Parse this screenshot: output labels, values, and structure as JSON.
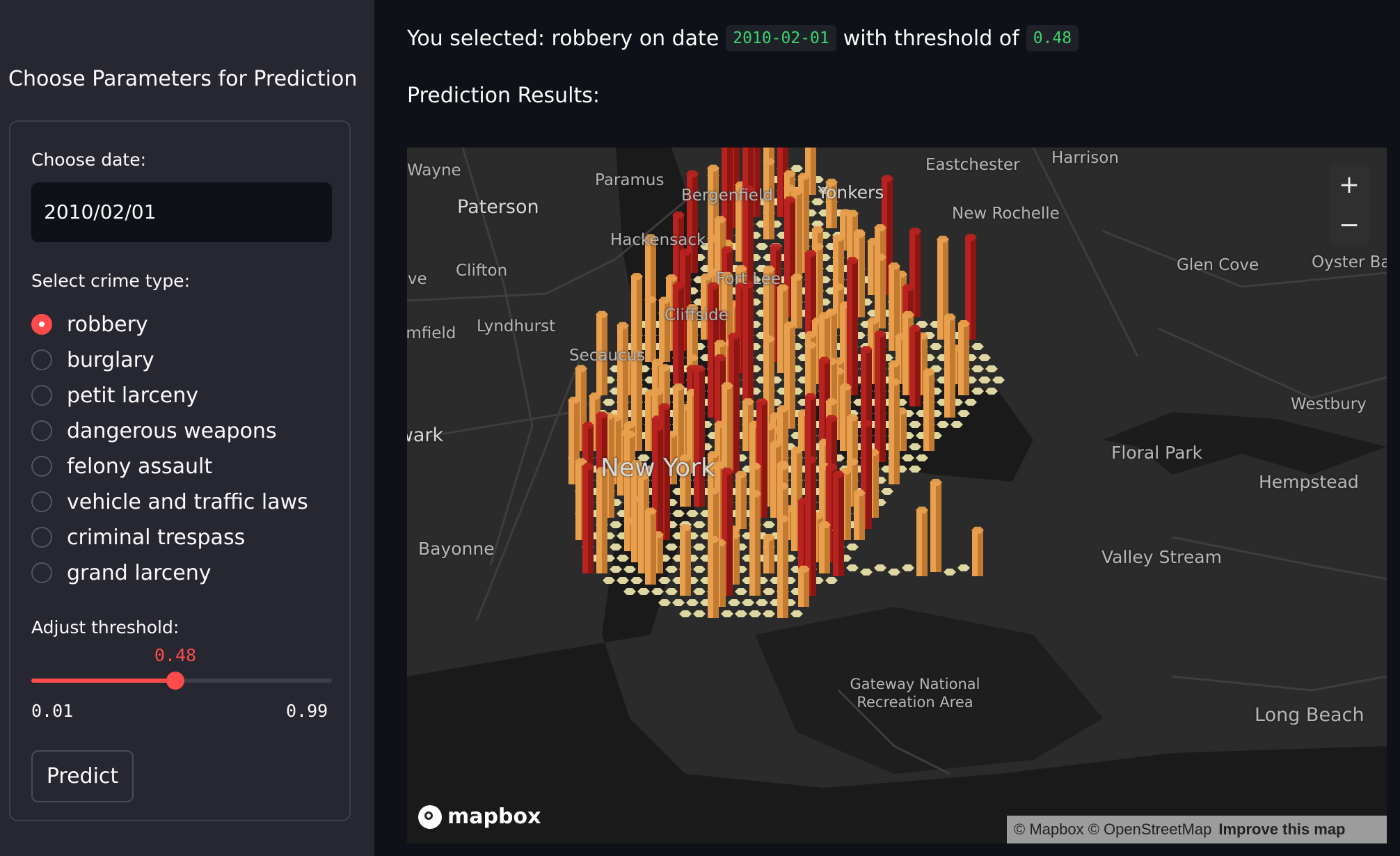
{
  "sidebar": {
    "title": "Choose Parameters for Prediction",
    "date_label": "Choose date:",
    "date_value": "2010/02/01",
    "crime_label": "Select crime type:",
    "crime_options": [
      "robbery",
      "burglary",
      "petit larceny",
      "dangerous weapons",
      "felony assault",
      "vehicle and traffic laws",
      "criminal trespass",
      "grand larceny"
    ],
    "selected_crime": "robbery",
    "threshold_label": "Adjust threshold:",
    "threshold_value": "0.48",
    "threshold_min": "0.01",
    "threshold_max": "0.99",
    "threshold_fraction": 0.48,
    "predict_label": "Predict"
  },
  "main": {
    "selected_prefix": "You selected: robbery on date",
    "selected_date": "2010-02-01",
    "selected_mid": "with threshold of",
    "selected_threshold": "0.48",
    "results_title": "Prediction Results:"
  },
  "map": {
    "places": [
      "Wayne",
      "Paramus",
      "Bergenfield",
      "Yonkers",
      "Eastchester",
      "Harrison",
      "Paterson",
      "New Rochelle",
      "Hackensack",
      "Clifton",
      "Fort Lee",
      "Glen Cove",
      "Oyster Bay",
      "Grove",
      "Lyndhurst",
      "Cliffside",
      "Bloomfield",
      "Secaucus",
      "Westbury",
      "Newark",
      "Floral Park",
      "New York",
      "Hempstead",
      "Bayonne",
      "Valley Stream",
      "Gateway National Recreation Area",
      "Long Beach"
    ],
    "zoom_in": "+",
    "zoom_out": "−",
    "logo_text": "mapbox",
    "attribution": "© Mapbox © OpenStreetMap",
    "improve_link": "Improve this map",
    "colors": {
      "low": "#e8e0a8",
      "mid": "#e9a04e",
      "high": "#b8231f"
    }
  }
}
